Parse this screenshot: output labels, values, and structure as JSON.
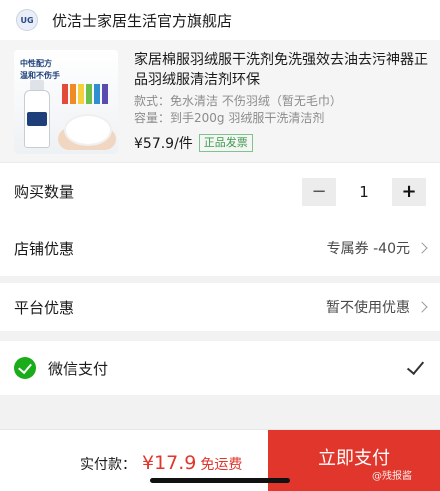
{
  "store": {
    "logo_text": "UG",
    "name": "优洁士家居生活官方旗舰店"
  },
  "product": {
    "image_caption_line1": "中性配方",
    "image_caption_line2": "温和不伤手",
    "title": "家居棉服羽绒服干洗剂免洗强效去油去污神器正品羽绒服清洁剂环保",
    "spec_style": "款式：免水清洁 不伤羽绒（暂无毛巾）",
    "spec_capacity": "容量：到手200g 羽绒服干洗清洁剂",
    "price": "¥57.9/件",
    "invoice_badge": "正品发票"
  },
  "quantity": {
    "label": "购买数量",
    "value": "1",
    "minus": "−",
    "plus": "+"
  },
  "shop_discount": {
    "label": "店铺优惠",
    "value": "专属券 -40元"
  },
  "platform_discount": {
    "label": "平台优惠",
    "value": "暂不使用优惠"
  },
  "payment": {
    "method": "微信支付",
    "icon": "wechat-pay-icon",
    "selected": true
  },
  "footer": {
    "pay_label": "实付款：",
    "amount": "¥17.9",
    "shipping": "免运费",
    "submit": "立即支付"
  },
  "watermark": "@残报酱",
  "colors": {
    "accent": "#e0362c",
    "wechat": "#1aad19",
    "badge": "#3a9b4a"
  }
}
